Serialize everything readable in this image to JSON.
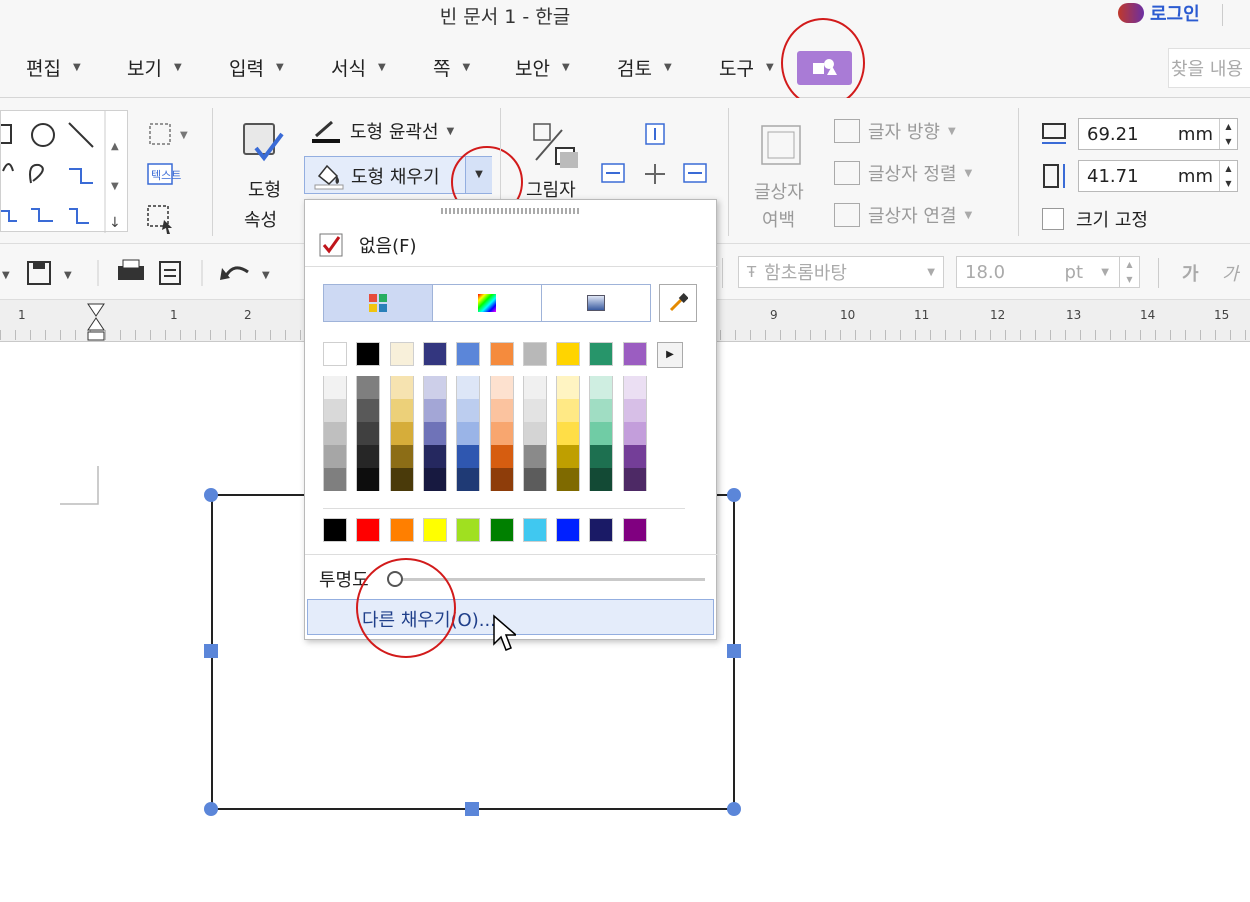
{
  "window": {
    "title": "빈 문서 1 - 한글",
    "login_label": "로그인"
  },
  "menu": {
    "items": [
      "편집",
      "보기",
      "입력",
      "서식",
      "쪽",
      "보안",
      "검토",
      "도구"
    ],
    "search_placeholder": "찾을 내용"
  },
  "ribbon": {
    "shape_properties": [
      "도형",
      "속성"
    ],
    "outline_label": "도형 윤곽선",
    "fill_label": "도형 채우기",
    "shadow_label": "그림자",
    "text_margin": [
      "글상자",
      "여백"
    ],
    "text_direction": "글자 방향",
    "text_align": "글상자 정렬",
    "text_link": "글상자 연결",
    "width_value": "69.21",
    "height_value": "41.71",
    "unit": "mm",
    "fix_size_label": "크기 고정",
    "shape_gallery_icon": "텍스트"
  },
  "toolbar2": {
    "font_name": "함초롬바탕",
    "font_size": "18.0",
    "font_unit": "pt",
    "char_a": "가",
    "char_b": "가"
  },
  "ruler": {
    "ticks": [
      "1",
      "1",
      "2",
      "9",
      "10",
      "11",
      "12",
      "13",
      "14",
      "15"
    ]
  },
  "dropdown": {
    "none_label": "없음(F)",
    "basic_colors": [
      "#ffffff",
      "#000000",
      "#f8f0da",
      "#33367f",
      "#5b86d9",
      "#f58b3d",
      "#b8b8b8",
      "#ffd400",
      "#27956a",
      "#9b5dc1"
    ],
    "shade_columns": [
      [
        "#f2f2f2",
        "#d9d9d9",
        "#bfbfbf",
        "#a6a6a6",
        "#7f7f7f"
      ],
      [
        "#7f7f7f",
        "#595959",
        "#404040",
        "#262626",
        "#0d0d0d"
      ],
      [
        "#f6e3b0",
        "#ecd079",
        "#d6ad3a",
        "#8c6d16",
        "#4a3a0a"
      ],
      [
        "#cdcfe9",
        "#a3a6d6",
        "#6f73b8",
        "#25285f",
        "#171940"
      ],
      [
        "#dde6f7",
        "#bccdef",
        "#9ab4e7",
        "#2f57b0",
        "#1f3a75"
      ],
      [
        "#fde1cf",
        "#fbc39f",
        "#f8a66f",
        "#d65d10",
        "#8e3d0a"
      ],
      [
        "#f0f0f0",
        "#e3e3e3",
        "#d4d4d4",
        "#8a8a8a",
        "#5c5c5c"
      ],
      [
        "#fff4c2",
        "#ffe985",
        "#ffde47",
        "#bf9f00",
        "#7f6a00"
      ],
      [
        "#cfeee1",
        "#a0ddc3",
        "#70cca5",
        "#1d7050",
        "#134a35"
      ],
      [
        "#ebdff3",
        "#d7bfe7",
        "#c39edb",
        "#743e98",
        "#4d2965"
      ]
    ],
    "standard_colors": [
      "#000000",
      "#ff0000",
      "#ff7f00",
      "#ffff00",
      "#a0e020",
      "#008000",
      "#40c8f0",
      "#0020ff",
      "#1a1a66",
      "#800080"
    ],
    "transparency_label": "투명도",
    "transparency_value": 0,
    "more_fills_label": "다른 채우기(O)..."
  }
}
